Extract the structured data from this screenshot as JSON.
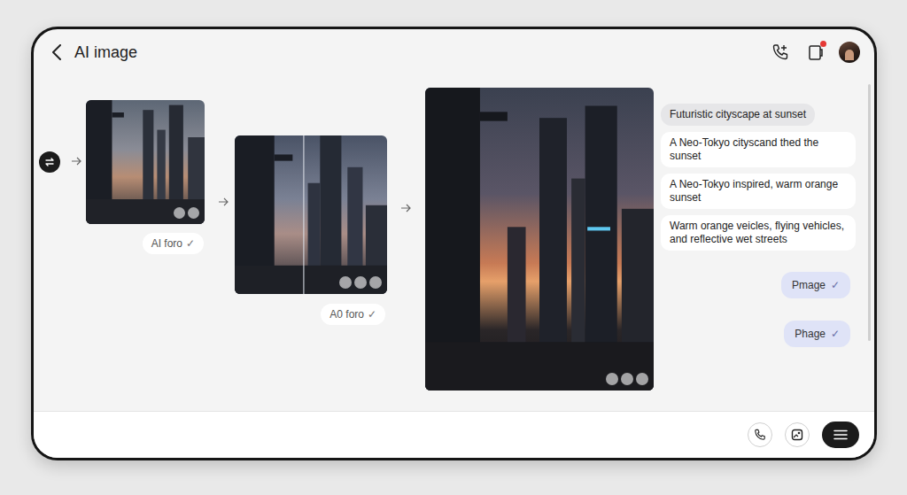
{
  "header": {
    "title": "AI image",
    "has_notification": true
  },
  "flow": [
    {
      "label": "AI foro",
      "check": "✓"
    },
    {
      "label": "A0 foro",
      "check": "✓"
    }
  ],
  "prompts": [
    "Futuristic cityscape at sunset",
    "A Neo-Tokyo cityscand thed the sunset",
    "A Neo-Tokyo inspired, warm orange sunset",
    "Warm orange veicles, flying vehicles, and reflective wet streets"
  ],
  "replies": [
    {
      "text": "Pmage",
      "check": "✓"
    },
    {
      "text": "Phage",
      "check": "✓"
    }
  ]
}
